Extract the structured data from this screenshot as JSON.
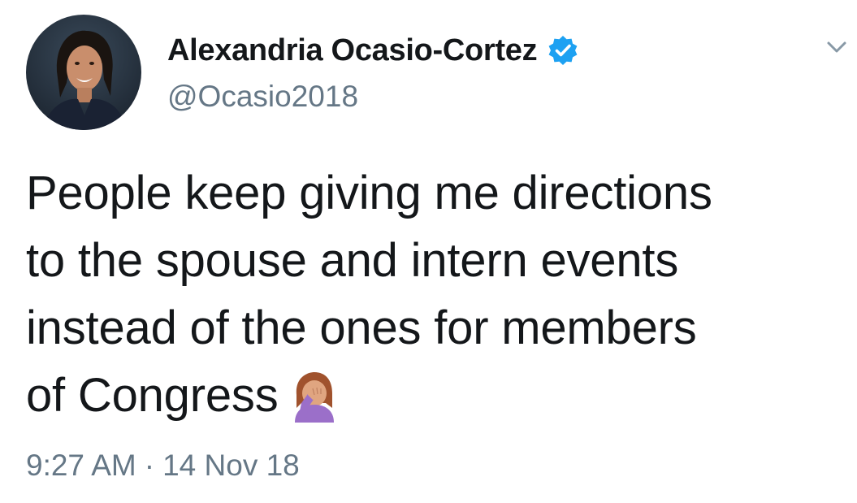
{
  "author": {
    "display_name": "Alexandria Ocasio-Cortez",
    "handle": "@Ocasio2018",
    "verified": true,
    "avatar_icon": "profile-photo"
  },
  "tweet": {
    "lines": [
      "People keep giving me directions",
      "to the spouse and intern events",
      "instead of the ones for members",
      "of Congress"
    ],
    "emoji": "woman-facepalming-emoji",
    "time": "9:27 AM",
    "separator": "·",
    "date": "14 Nov 18"
  },
  "icons": {
    "verified": "verified-badge-icon",
    "menu": "chevron-down-icon"
  },
  "colors": {
    "text": "#14171a",
    "secondary": "#657786",
    "verified_blue": "#1da1f2",
    "background": "#ffffff"
  }
}
